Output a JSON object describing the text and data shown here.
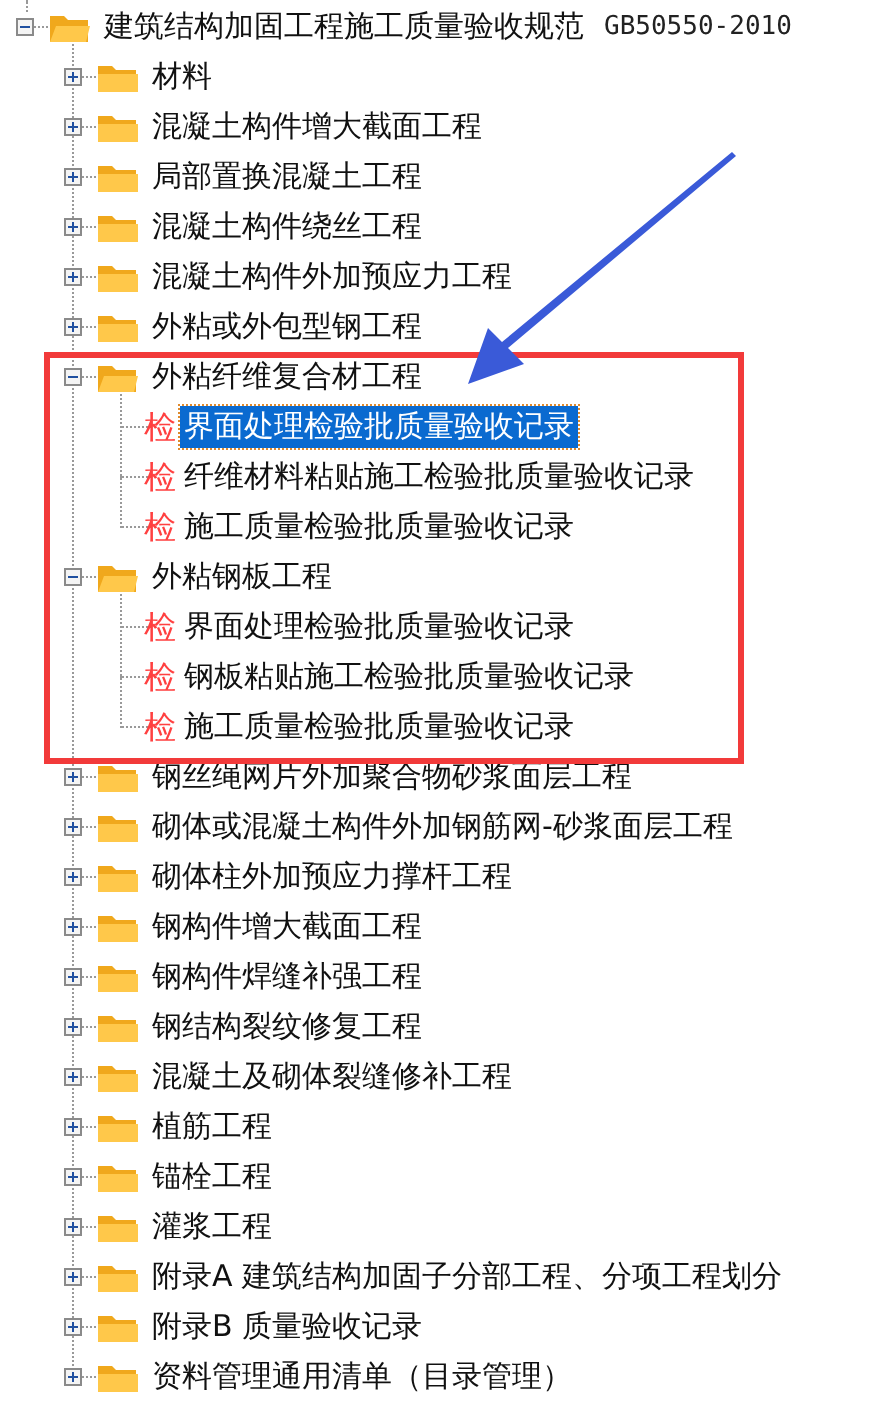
{
  "tree": [
    {
      "label": "建筑结构加固工程施工质量验收规范",
      "code": "GB50550-2010",
      "expanded": true,
      "children": [
        {
          "label": "材料",
          "expanded": false
        },
        {
          "label": "混凝土构件增大截面工程",
          "expanded": false
        },
        {
          "label": "局部置换混凝土工程",
          "expanded": false
        },
        {
          "label": "混凝土构件绕丝工程",
          "expanded": false
        },
        {
          "label": "混凝土构件外加预应力工程",
          "expanded": false
        },
        {
          "label": "外粘或外包型钢工程",
          "expanded": false
        },
        {
          "label": "外粘纤维复合材工程",
          "expanded": true,
          "children": [
            {
              "kind": "record",
              "badge": "检",
              "label": "界面处理检验批质量验收记录",
              "selected": true
            },
            {
              "kind": "record",
              "badge": "检",
              "label": "纤维材料粘贴施工检验批质量验收记录",
              "selected": false
            },
            {
              "kind": "record",
              "badge": "检",
              "label": "施工质量检验批质量验收记录",
              "selected": false
            }
          ]
        },
        {
          "label": "外粘钢板工程",
          "expanded": true,
          "children": [
            {
              "kind": "record",
              "badge": "检",
              "label": "界面处理检验批质量验收记录",
              "selected": false
            },
            {
              "kind": "record",
              "badge": "检",
              "label": "钢板粘贴施工检验批质量验收记录",
              "selected": false
            },
            {
              "kind": "record",
              "badge": "检",
              "label": "施工质量检验批质量验收记录",
              "selected": false
            }
          ]
        },
        {
          "label": "钢丝绳网片外加聚合物砂浆面层工程",
          "expanded": false
        },
        {
          "label": "砌体或混凝土构件外加钢筋网-砂浆面层工程",
          "expanded": false
        },
        {
          "label": "砌体柱外加预应力撑杆工程",
          "expanded": false
        },
        {
          "label": "钢构件增大截面工程",
          "expanded": false
        },
        {
          "label": "钢构件焊缝补强工程",
          "expanded": false
        },
        {
          "label": "钢结构裂纹修复工程",
          "expanded": false
        },
        {
          "label": "混凝土及砌体裂缝修补工程",
          "expanded": false
        },
        {
          "label": "植筋工程",
          "expanded": false
        },
        {
          "label": "锚栓工程",
          "expanded": false
        },
        {
          "label": "灌浆工程",
          "expanded": false
        },
        {
          "label": "附录A 建筑结构加固子分部工程、分项工程划分",
          "expanded": false
        },
        {
          "label": "附录B 质量验收记录",
          "expanded": false
        },
        {
          "label": "资料管理通用清单（目录管理）",
          "expanded": false
        }
      ]
    }
  ]
}
